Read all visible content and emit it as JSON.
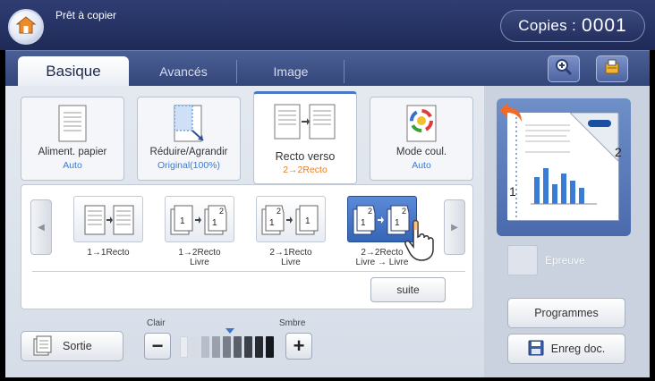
{
  "status": {
    "text": "Prêt à copier"
  },
  "copies": {
    "label": "Copies :",
    "value": "0001"
  },
  "tabs": [
    {
      "label": "Basique",
      "active": true
    },
    {
      "label": "Avancés",
      "active": false
    },
    {
      "label": "Image",
      "active": false
    }
  ],
  "toolbar": {
    "zoom_icon": "zoom-in-icon",
    "job_icon": "job-status-icon"
  },
  "features": [
    {
      "title": "Aliment. papier",
      "value": "Auto",
      "value_color": "#3a7bd5"
    },
    {
      "title": "Réduire/Agrandir",
      "value": "Original(100%)",
      "value_color": "#3a7bd5"
    },
    {
      "title": "Recto verso",
      "value": "2→2Recto",
      "value_color": "#f07b18",
      "selected": true
    },
    {
      "title": "Mode coul.",
      "value": "Auto",
      "value_color": "#3a7bd5"
    }
  ],
  "duplex_options": [
    {
      "line1": "1→1Recto",
      "line2": "",
      "selected": false
    },
    {
      "line1": "1→2Recto",
      "line2": "Livre",
      "selected": false
    },
    {
      "line1": "2→1Recto",
      "line2": "Livre",
      "selected": false
    },
    {
      "line1": "2→2Recto",
      "line2": "Livre → Livre",
      "selected": true
    }
  ],
  "more_button": "suite",
  "output_button": "Sortie",
  "density": {
    "light_label": "Clair",
    "dark_label": "Smbre",
    "minus": "−",
    "plus": "+"
  },
  "preview": {
    "page_number_front": "1",
    "page_number_back": "2"
  },
  "proof": {
    "label": "Epreuve"
  },
  "programs_button": "Programmes",
  "save_doc_button": "Enreg doc."
}
